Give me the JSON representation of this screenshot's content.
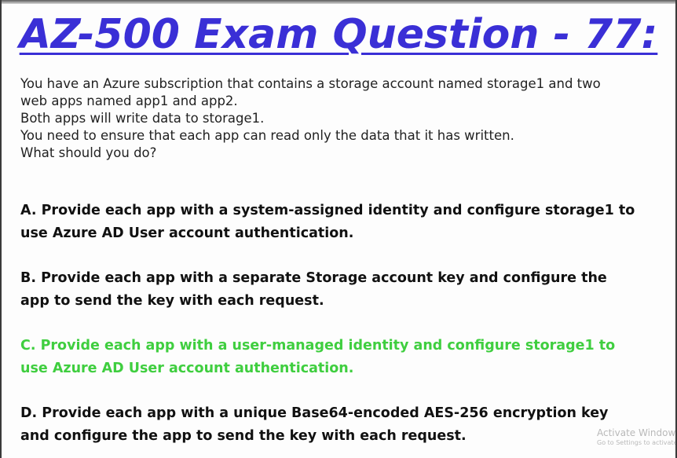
{
  "title": "AZ-500 Exam Question - 77:",
  "question": {
    "lines": [
      "You have an Azure subscription that contains a storage account named storage1 and two",
      "web apps named app1 and app2.",
      "Both apps will write data to storage1.",
      "You need to ensure that each app can read only the data that it has written.",
      "What should you do?"
    ]
  },
  "options": [
    {
      "lines": [
        "A. Provide each app with a system-assigned identity and configure storage1 to",
        "use Azure AD User account authentication."
      ],
      "correct": false
    },
    {
      "lines": [
        "B. Provide each app with a separate Storage account key and configure the",
        "app to send the key with each request."
      ],
      "correct": false
    },
    {
      "lines": [
        "C. Provide each app with a user-managed identity and configure storage1 to",
        "use Azure AD User account authentication."
      ],
      "correct": true
    },
    {
      "lines": [
        "D. Provide each app with a unique Base64-encoded AES-256 encryption key",
        "and configure the app to send the key with each request."
      ],
      "correct": false
    }
  ],
  "watermark": {
    "main": "Activate Windows",
    "sub": "Go to Settings to activate Windows."
  },
  "colors": {
    "title": "#3a2fd6",
    "correct": "#3fce3f",
    "text": "#111111"
  }
}
